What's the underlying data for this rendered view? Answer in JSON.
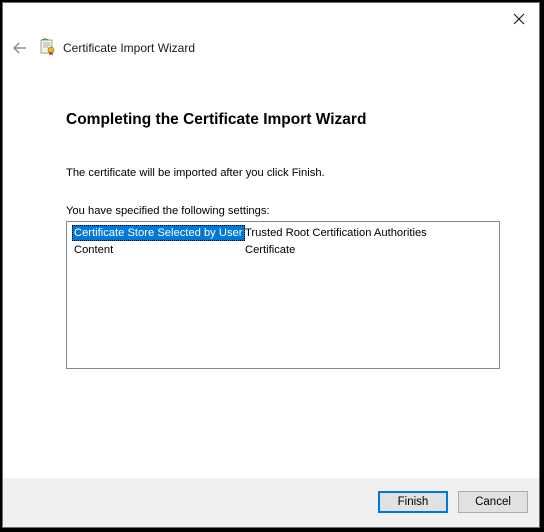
{
  "window": {
    "close_icon": "close-icon",
    "back_icon": "back-arrow-icon",
    "wizard_icon": "certificate-icon",
    "title": "Certificate Import Wizard"
  },
  "content": {
    "heading": "Completing the Certificate Import Wizard",
    "description": "The certificate will be imported after you click Finish.",
    "settings_label": "You have specified the following settings:",
    "settings": [
      {
        "key": "Certificate Store Selected by User",
        "value": "Trusted Root Certification Authorities",
        "selected": true
      },
      {
        "key": "Content",
        "value": "Certificate",
        "selected": false
      }
    ]
  },
  "footer": {
    "finish_label": "Finish",
    "cancel_label": "Cancel"
  },
  "colors": {
    "accent": "#0078d7",
    "footer_bg": "#f0f0f0"
  }
}
